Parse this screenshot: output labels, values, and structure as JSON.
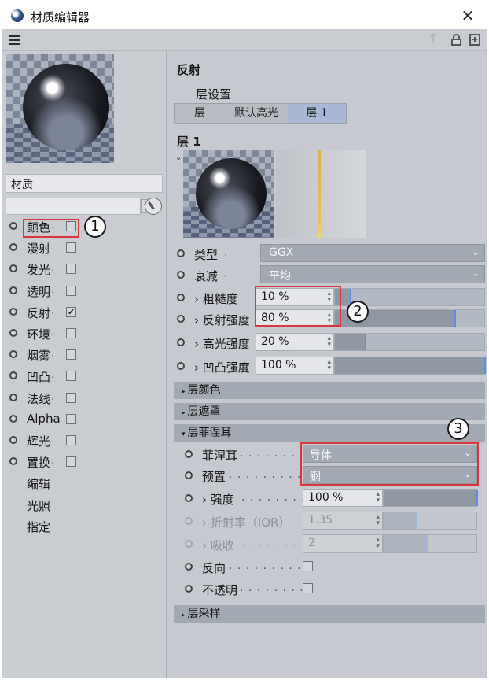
{
  "window": {
    "title": "材质编辑器",
    "close": "✕"
  },
  "toolbar": {
    "menu_icon": "menu-icon",
    "up_icon": "arrow-up-icon",
    "lock_icon": "lock-icon",
    "new_icon": "new-window-icon"
  },
  "left": {
    "material_name": "材质",
    "channels": [
      {
        "label": "颜色",
        "checked": false
      },
      {
        "label": "漫射",
        "checked": false
      },
      {
        "label": "发光",
        "checked": false
      },
      {
        "label": "透明",
        "checked": false
      },
      {
        "label": "反射",
        "checked": true
      },
      {
        "label": "环境",
        "checked": false
      },
      {
        "label": "烟雾",
        "checked": false
      },
      {
        "label": "凹凸",
        "checked": false
      },
      {
        "label": "法线",
        "checked": false
      },
      {
        "label": "Alpha",
        "checked": false
      },
      {
        "label": "辉光",
        "checked": false
      },
      {
        "label": "置换",
        "checked": false
      }
    ],
    "extra": [
      "编辑",
      "光照",
      "指定"
    ],
    "check_mark": "✔"
  },
  "right": {
    "section_title": "反射",
    "layer_settings": "层设置",
    "tabs": [
      "层",
      "默认高光",
      "层 1"
    ],
    "active_tab": 2,
    "layer_title": "层 1",
    "collapse_glyph": "⌄",
    "type": {
      "label": "类型",
      "value": "GGX"
    },
    "attenuation": {
      "label": "衰减",
      "value": "平均"
    },
    "params": [
      {
        "label": "› 粗糙度",
        "value": "10 %",
        "fraction": 0.1
      },
      {
        "label": "› 反射强度",
        "value": "80 %",
        "fraction": 0.8
      },
      {
        "label": "› 高光强度",
        "value": "20 %",
        "fraction": 0.2
      },
      {
        "label": "› 凹凸强度",
        "value": "100 %",
        "fraction": 1.0
      }
    ],
    "groups": {
      "layer_color": "层颜色",
      "layer_mask": "层遮罩",
      "layer_fresnel": "层菲涅耳",
      "layer_sampling": "层采样"
    },
    "fresnel": {
      "mode": {
        "label": "菲涅耳",
        "value": "导体"
      },
      "preset": {
        "label": "预置",
        "value": "钢"
      },
      "strength": {
        "label": "› 强度",
        "value": "100 %",
        "fraction": 1.0
      },
      "ior": {
        "label": "› 折射率（IOR）",
        "value": "1.35",
        "fraction": 0.35
      },
      "absorb": {
        "label": "› 吸收",
        "value": "2",
        "fraction": 0.45
      },
      "invert": {
        "label": "反向"
      },
      "opaque": {
        "label": "不透明"
      }
    }
  },
  "annotations": [
    "1",
    "2",
    "3"
  ],
  "colors": {
    "highlight": "#d9363e",
    "active_tab": "#a9b9d5",
    "slider_knob": "#5b8de0"
  }
}
